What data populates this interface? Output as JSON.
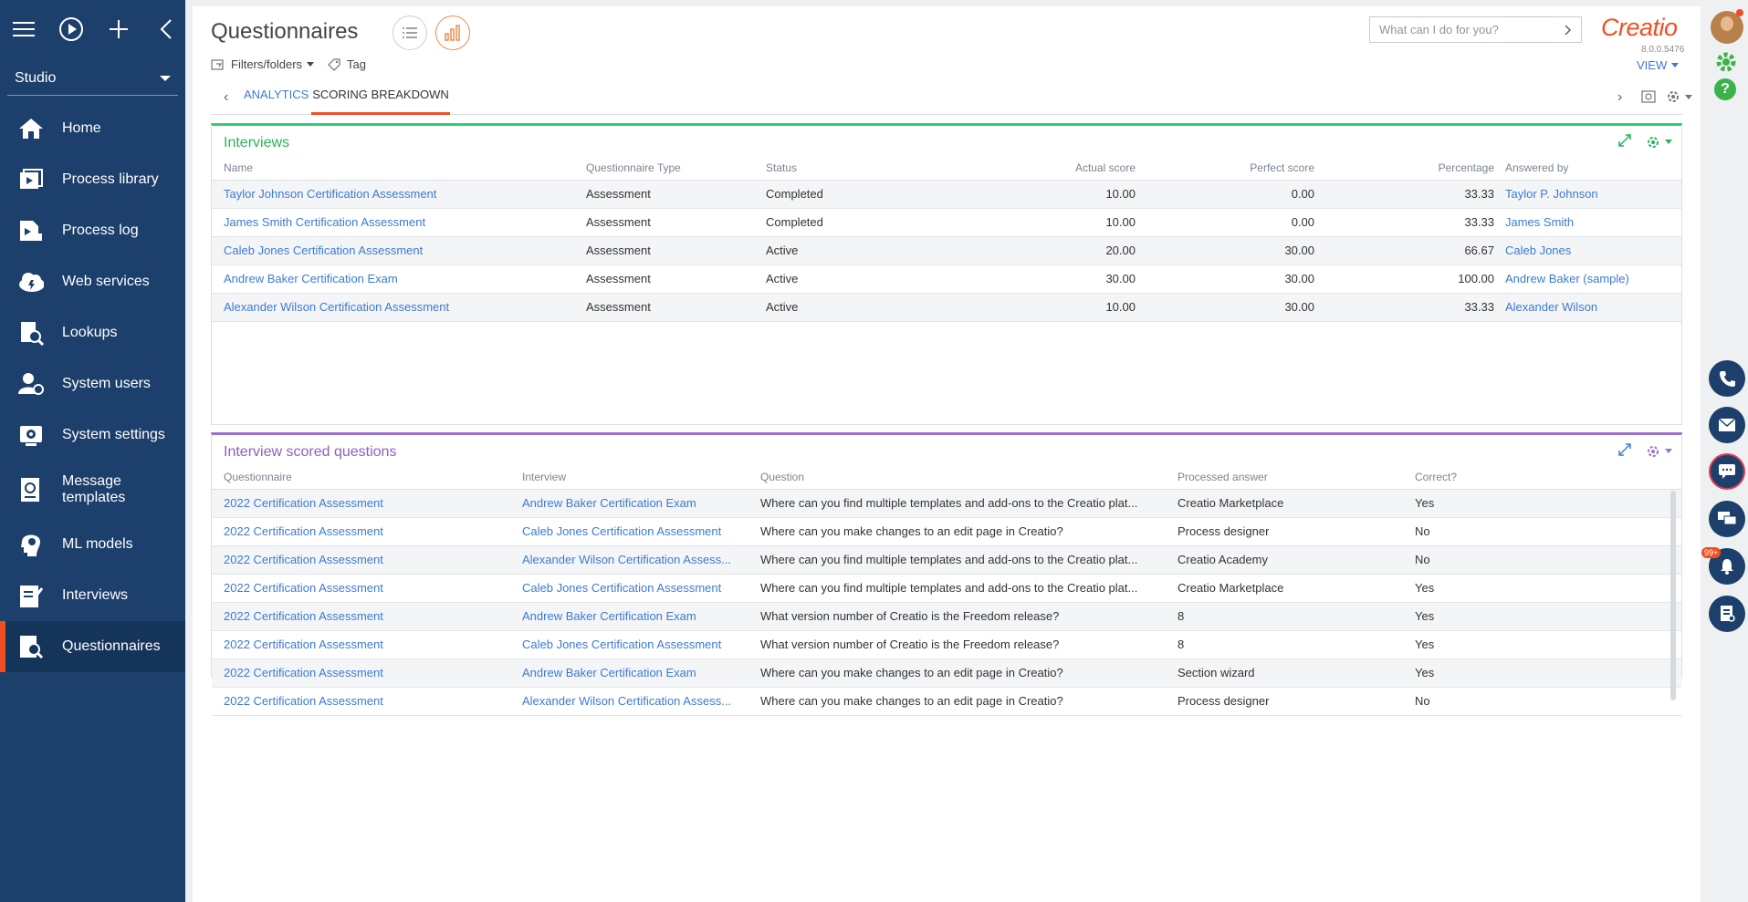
{
  "sidebar": {
    "workplace": "Studio",
    "items": [
      {
        "label": "Home",
        "icon": "home-icon"
      },
      {
        "label": "Process library",
        "icon": "process-library-icon"
      },
      {
        "label": "Process log",
        "icon": "process-log-icon"
      },
      {
        "label": "Web services",
        "icon": "web-services-icon"
      },
      {
        "label": "Lookups",
        "icon": "lookups-icon"
      },
      {
        "label": "System users",
        "icon": "system-users-icon"
      },
      {
        "label": "System settings",
        "icon": "system-settings-icon"
      },
      {
        "label": "Message templates",
        "icon": "message-templates-icon"
      },
      {
        "label": "ML models",
        "icon": "ml-models-icon"
      },
      {
        "label": "Interviews",
        "icon": "interviews-icon"
      },
      {
        "label": "Questionnaires",
        "icon": "questionnaires-icon",
        "active": true
      }
    ]
  },
  "header": {
    "title": "Questionnaires",
    "search_placeholder": "What can I do for you?",
    "logo": "Creatio",
    "version": "8.0.0.5476",
    "filters_label": "Filters/folders",
    "tag_label": "Tag",
    "view_label": "VIEW"
  },
  "tabs": {
    "analytics": "ANALYTICS",
    "scoring": "SCORING BREAKDOWN"
  },
  "interviews": {
    "title": "Interviews",
    "columns": [
      "Name",
      "Questionnaire Type",
      "Status",
      "Actual score",
      "Perfect score",
      "Percentage",
      "Answered by"
    ],
    "rows": [
      [
        "Taylor Johnson Certification Assessment",
        "Assessment",
        "Completed",
        "10.00",
        "0.00",
        "33.33",
        "Taylor P. Johnson"
      ],
      [
        "James Smith Certification Assessment",
        "Assessment",
        "Completed",
        "10.00",
        "0.00",
        "33.33",
        "James Smith"
      ],
      [
        "Caleb Jones Certification Assessment",
        "Assessment",
        "Active",
        "20.00",
        "30.00",
        "66.67",
        "Caleb Jones"
      ],
      [
        "Andrew Baker Certification Exam",
        "Assessment",
        "Active",
        "30.00",
        "30.00",
        "100.00",
        "Andrew Baker (sample)"
      ],
      [
        "Alexander Wilson Certification Assessment",
        "Assessment",
        "Active",
        "10.00",
        "30.00",
        "33.33",
        "Alexander Wilson"
      ]
    ]
  },
  "questions": {
    "title": "Interview scored questions",
    "columns": [
      "Questionnaire",
      "Interview",
      "Question",
      "Processed answer",
      "Correct?"
    ],
    "rows": [
      [
        "2022 Certification Assessment",
        "Andrew Baker Certification Exam",
        "Where can you find multiple templates and add-ons to the Creatio plat...",
        "Creatio Marketplace",
        "Yes"
      ],
      [
        "2022 Certification Assessment",
        "Caleb Jones Certification Assessment",
        "Where can you make changes to an edit page in Creatio?",
        "Process designer",
        "No"
      ],
      [
        "2022 Certification Assessment",
        "Alexander Wilson Certification Assess...",
        "Where can you find multiple templates and add-ons to the Creatio plat...",
        "Creatio Academy",
        "No"
      ],
      [
        "2022 Certification Assessment",
        "Caleb Jones Certification Assessment",
        "Where can you find multiple templates and add-ons to the Creatio plat...",
        "Creatio Marketplace",
        "Yes"
      ],
      [
        "2022 Certification Assessment",
        "Andrew Baker Certification Exam",
        "What version number of Creatio is the Freedom release?",
        "8",
        "Yes"
      ],
      [
        "2022 Certification Assessment",
        "Caleb Jones Certification Assessment",
        "What version number of Creatio is the Freedom release?",
        "8",
        "Yes"
      ],
      [
        "2022 Certification Assessment",
        "Andrew Baker Certification Exam",
        "Where can you make changes to an edit page in Creatio?",
        "Section wizard",
        "Yes"
      ],
      [
        "2022 Certification Assessment",
        "Alexander Wilson Certification Assess...",
        "Where can you make changes to an edit page in Creatio?",
        "Process designer",
        "No"
      ]
    ]
  },
  "rail": {
    "notification_badge": "99+"
  },
  "colors": {
    "sidebar": "#1c3f6b",
    "accent": "#f04e23",
    "link": "#3d7bd0",
    "interviews_accent": "#2ecc71",
    "questions_accent": "#9b6fd0"
  }
}
